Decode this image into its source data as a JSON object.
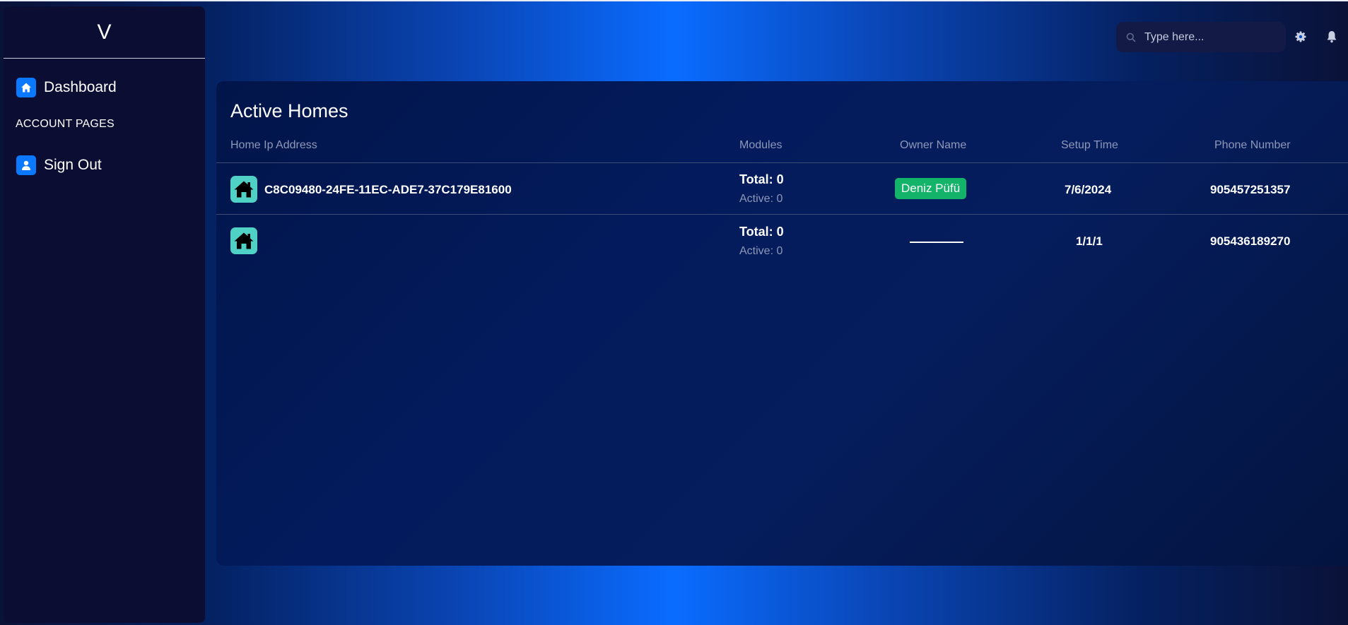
{
  "sidebar": {
    "brand": "V",
    "items": [
      {
        "label": "Dashboard",
        "icon": "home-icon"
      },
      {
        "label": "Sign Out",
        "icon": "user-icon"
      }
    ],
    "section_label": "ACCOUNT PAGES"
  },
  "topbar": {
    "search_placeholder": "Type here...",
    "icons": [
      "search-icon",
      "gear-icon",
      "bell-icon"
    ]
  },
  "panel": {
    "title": "Active Homes",
    "columns": [
      "Home Ip Address",
      "Modules",
      "Owner Name",
      "Setup Time",
      "Phone Number"
    ],
    "rows": [
      {
        "home_ip": "C8C09480-24FE-11EC-ADE7-37C179E81600",
        "modules_total": "Total: 0",
        "modules_active": "Active: 0",
        "owner": "Deniz Püfü",
        "setup_time": "7/6/2024",
        "phone": "905457251357"
      },
      {
        "home_ip": "",
        "modules_total": "Total: 0",
        "modules_active": "Active: 0",
        "owner": "",
        "setup_time": "1/1/1",
        "phone": "905436189270"
      }
    ]
  },
  "colors": {
    "accent": "#0a78ff",
    "home_icon_bg": "#4fd1c5",
    "owner_badge": "#14b36a",
    "sidebar_bg": "#0b0d33"
  }
}
